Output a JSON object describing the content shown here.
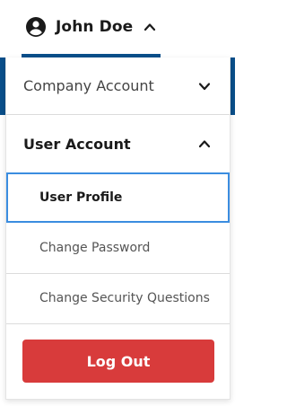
{
  "header": {
    "user_name": "John Doe",
    "user_icon": "account-circle-icon",
    "toggle_icon": "chevron-up-icon"
  },
  "menu": {
    "company_account": {
      "label": "Company Account",
      "icon": "chevron-down-icon",
      "expanded": false
    },
    "user_account": {
      "label": "User Account",
      "icon": "chevron-up-icon",
      "expanded": true,
      "items": [
        {
          "label": "User Profile",
          "active": true
        },
        {
          "label": "Change Password",
          "active": false
        },
        {
          "label": "Change Security Questions",
          "active": false
        }
      ]
    }
  },
  "logout": {
    "label": "Log Out"
  },
  "colors": {
    "accent_blue": "#0a4f8a",
    "focus_blue": "#3b8de0",
    "logout_red": "#d83b3b"
  }
}
